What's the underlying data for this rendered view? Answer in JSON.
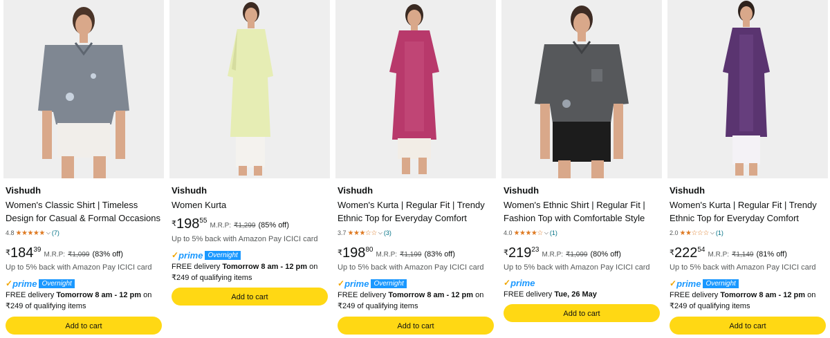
{
  "products": [
    {
      "brand": "Vishudh",
      "title_line1": "Women's Classic Shirt | Timeless",
      "title_line2": "Design for Casual & Formal Occasions",
      "rating": "4.8",
      "stars": "★★★★★",
      "rating_count": "(7)",
      "currency": "₹",
      "price_whole": "184",
      "price_fraction": "39",
      "mrp_label": "M.R.P:",
      "mrp": "₹1,099",
      "discount": "(83% off)",
      "cashback": "Up to 5% back with Amazon Pay ICICI card",
      "prime_check": "✓",
      "prime_label": "prime",
      "overnight": "Overnight",
      "delivery_prefix": "FREE delivery",
      "delivery_bold": "Tomorrow 8 am - 12 pm",
      "delivery_suffix": "on",
      "delivery_line2": "₹249 of qualifying items",
      "cta": "Add to cart"
    },
    {
      "brand": "Vishudh",
      "title_line1": "Women Kurta",
      "currency": "₹",
      "price_whole": "198",
      "price_fraction": "55",
      "mrp_label": "M.R.P:",
      "mrp": "₹1,299",
      "discount": "(85% off)",
      "cashback": "Up to 5% back with Amazon Pay ICICI card",
      "prime_check": "✓",
      "prime_label": "prime",
      "overnight": "Overnight",
      "delivery_prefix": "FREE delivery",
      "delivery_bold": "Tomorrow 8 am - 12 pm",
      "delivery_suffix": "on",
      "delivery_line2": "₹249 of qualifying items",
      "cta": "Add to cart"
    },
    {
      "brand": "Vishudh",
      "title_line1": "Women's Kurta | Regular Fit | Trendy",
      "title_line2": "Ethnic Top for Everyday Comfort",
      "rating": "3.7",
      "stars": "★★★☆☆",
      "rating_count": "(3)",
      "currency": "₹",
      "price_whole": "198",
      "price_fraction": "80",
      "mrp_label": "M.R.P:",
      "mrp": "₹1,199",
      "discount": "(83% off)",
      "cashback": "Up to 5% back with Amazon Pay ICICI card",
      "prime_check": "✓",
      "prime_label": "prime",
      "overnight": "Overnight",
      "delivery_prefix": "FREE delivery",
      "delivery_bold": "Tomorrow 8 am - 12 pm",
      "delivery_suffix": "on",
      "delivery_line2": "₹249 of qualifying items",
      "cta": "Add to cart"
    },
    {
      "brand": "Vishudh",
      "title_line1": "Women's Ethnic Shirt | Regular Fit |",
      "title_line2": "Fashion Top with Comfortable Style",
      "rating": "4.0",
      "stars": "★★★★☆",
      "rating_count": "(1)",
      "currency": "₹",
      "price_whole": "219",
      "price_fraction": "23",
      "mrp_label": "M.R.P:",
      "mrp": "₹1,099",
      "discount": "(80% off)",
      "cashback": "Up to 5% back with Amazon Pay ICICI card",
      "prime_check": "✓",
      "prime_label": "prime",
      "delivery_prefix": "FREE delivery",
      "delivery_bold": "Tue, 26 May",
      "cta": "Add to cart"
    },
    {
      "brand": "Vishudh",
      "title_line1": "Women's Kurta | Regular Fit | Trendy",
      "title_line2": "Ethnic Top for Everyday Comfort",
      "rating": "2.0",
      "stars": "★★☆☆☆",
      "rating_count": "(1)",
      "currency": "₹",
      "price_whole": "222",
      "price_fraction": "54",
      "mrp_label": "M.R.P:",
      "mrp": "₹1,149",
      "discount": "(81% off)",
      "cashback": "Up to 5% back with Amazon Pay ICICI card",
      "prime_check": "✓",
      "prime_label": "prime",
      "overnight": "Overnight",
      "delivery_prefix": "FREE delivery",
      "delivery_bold": "Tomorrow 8 am - 12 pm",
      "delivery_suffix": "on",
      "delivery_line2": "₹249 of qualifying items",
      "cta": "Add to cart"
    }
  ],
  "colors": {
    "button": "#FFD814",
    "star": "#DE7921",
    "prime_blue": "#1A98FF",
    "link": "#007185",
    "image_bg": "#EEEEEE",
    "product_1_shirt": "#7F8792",
    "product_2_kurta": "#E6EDB4",
    "product_3_kurta": "#B8396B",
    "product_4_shirt": "#56585B",
    "product_5_kurta": "#5A3470"
  },
  "icons": {
    "rating_dropdown": "chevron-down-icon",
    "prime_logo": "prime-logo-icon"
  }
}
